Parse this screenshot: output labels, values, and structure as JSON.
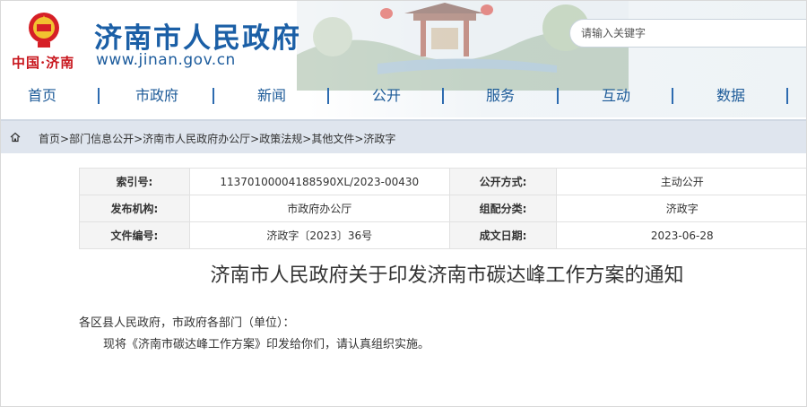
{
  "header": {
    "site_title": "济南市人民政府",
    "site_url": "www.jinan.gov.cn",
    "logo_text": "中国·济南",
    "search_placeholder": "请输入关键字"
  },
  "nav": {
    "items": [
      "首页",
      "市政府",
      "新闻",
      "公开",
      "服务",
      "互动",
      "数据"
    ]
  },
  "breadcrumb": {
    "items": [
      "首页",
      "部门信息公开",
      "济南市人民政府办公厅",
      "政策法规",
      "其他文件",
      "济政字"
    ],
    "separator": ">"
  },
  "info": {
    "rows": [
      {
        "label1": "索引号:",
        "value1": "11370100004188590XL/2023-00430",
        "label2": "公开方式:",
        "value2": "主动公开"
      },
      {
        "label1": "发布机构:",
        "value1": "市政府办公厅",
        "label2": "组配分类:",
        "value2": "济政字"
      },
      {
        "label1": "文件编号:",
        "value1": "济政字〔2023〕36号",
        "label2": "成文日期:",
        "value2": "2023-06-28"
      }
    ]
  },
  "document": {
    "title": "济南市人民政府关于印发济南市碳达峰工作方案的通知",
    "salutation": "各区县人民政府，市政府各部门（单位）：",
    "body": "现将《济南市碳达峰工作方案》印发给你们，请认真组织实施。"
  },
  "colors": {
    "brand_blue": "#1b5fa6",
    "emblem_red": "#c8161d",
    "crumb_bg": "#dfe5ee"
  },
  "icons": {
    "home": "home-icon",
    "emblem": "national-emblem-icon"
  }
}
